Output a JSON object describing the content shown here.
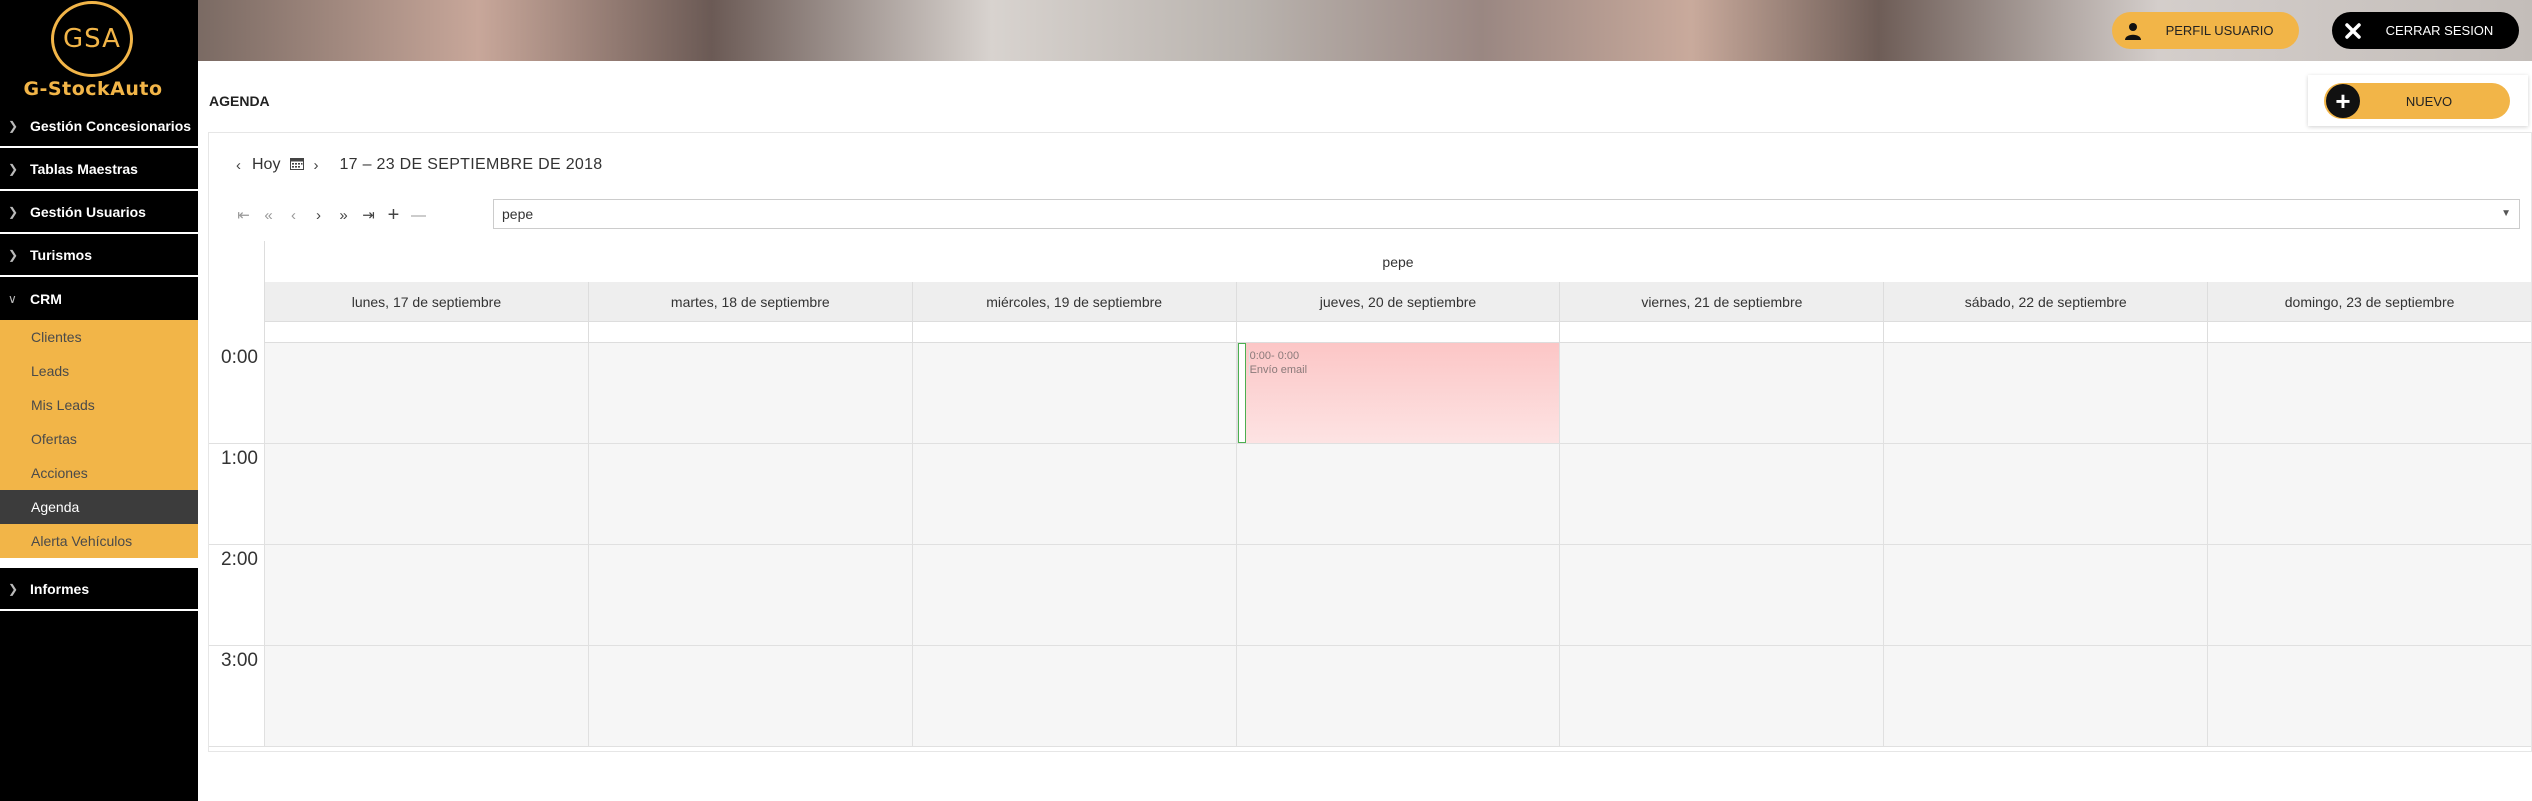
{
  "brand": {
    "logo_initials": "GSA",
    "logo_name": "G-StockAuto"
  },
  "sidebar": {
    "items": [
      {
        "label": "Gestión Concesionarios"
      },
      {
        "label": "Tablas Maestras"
      },
      {
        "label": "Gestión Usuarios"
      },
      {
        "label": "Turismos"
      },
      {
        "label": "CRM"
      }
    ],
    "crm_subitems": [
      {
        "label": "Clientes"
      },
      {
        "label": "Leads"
      },
      {
        "label": "Mis Leads"
      },
      {
        "label": "Ofertas"
      },
      {
        "label": "Acciones"
      },
      {
        "label": "Agenda"
      },
      {
        "label": "Alerta Vehículos"
      }
    ],
    "after_items": [
      {
        "label": "Informes"
      }
    ]
  },
  "header": {
    "profile_label": "PERFIL USUARIO",
    "logout_label": "CERRAR SESION"
  },
  "page": {
    "title": "AGENDA",
    "new_label": "NUEVO"
  },
  "calendar": {
    "today_label": "Hoy",
    "range_label": "17 – 23 DE SEPTIEMBRE DE 2018",
    "resource_value": "pepe",
    "resource_header": "pepe",
    "days": [
      "lunes, 17 de septiembre",
      "martes, 18 de septiembre",
      "miércoles, 19 de septiembre",
      "jueves, 20 de septiembre",
      "viernes, 21 de septiembre",
      "sábado, 22 de septiembre",
      "domingo, 23 de septiembre"
    ],
    "hours": [
      "0:00",
      "1:00",
      "2:00",
      "3:00"
    ],
    "event": {
      "time": "0:00- 0:00",
      "title": "Envío email",
      "day_index": 3
    }
  },
  "colors": {
    "accent": "#f2b548",
    "sidebar_bg": "#000000",
    "active_item": "#3c3c3c",
    "event_bg": "#fcc6c6",
    "event_border": "#4caf50"
  }
}
